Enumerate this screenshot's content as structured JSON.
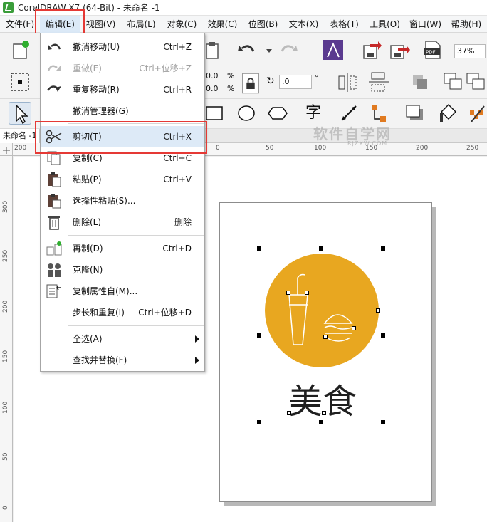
{
  "window": {
    "title": "CorelDRAW X7 (64-Bit) - 未命名 -1"
  },
  "menubar": {
    "items": [
      {
        "label": "文件(F)"
      },
      {
        "label": "编辑(E)"
      },
      {
        "label": "视图(V)"
      },
      {
        "label": "布局(L)"
      },
      {
        "label": "对象(C)"
      },
      {
        "label": "效果(C)"
      },
      {
        "label": "位图(B)"
      },
      {
        "label": "文本(X)"
      },
      {
        "label": "表格(T)"
      },
      {
        "label": "工具(O)"
      },
      {
        "label": "窗口(W)"
      },
      {
        "label": "帮助(H)"
      }
    ]
  },
  "toolbar": {
    "zoom_value": "37%",
    "field_a": "0.0",
    "field_b": "0.0",
    "percent_a": "%",
    "percent_b": "%",
    "rotate_value": ".0",
    "degree_symbol": "°",
    "char_tool": "字"
  },
  "document": {
    "tab_label": "未命名 -1"
  },
  "watermark": {
    "main": "软件自学网",
    "sub": "RJZXW.COM"
  },
  "ruler": {
    "h_labels": [
      "200",
      "150",
      "0",
      "50",
      "100",
      "150",
      "200",
      "250"
    ],
    "v_labels": [
      "300",
      "250",
      "200",
      "150",
      "100",
      "50",
      "0"
    ]
  },
  "artwork": {
    "text": "美食",
    "circle_color": "#E8A720"
  },
  "edit_menu": {
    "items": [
      {
        "label": "撤消移动(U)",
        "shortcut": "Ctrl+Z",
        "icon": "undo-icon",
        "disabled": false
      },
      {
        "label": "重做(E)",
        "shortcut": "Ctrl+位移+Z",
        "icon": "redo-icon",
        "disabled": true
      },
      {
        "label": "重复移动(R)",
        "shortcut": "Ctrl+R",
        "icon": "repeat-icon",
        "disabled": false
      },
      {
        "label": "撤消管理器(G)",
        "shortcut": "",
        "icon": "",
        "disabled": false
      },
      {
        "label": "剪切(T)",
        "shortcut": "Ctrl+X",
        "icon": "scissors-icon",
        "disabled": false,
        "highlighted": true
      },
      {
        "label": "复制(C)",
        "shortcut": "Ctrl+C",
        "icon": "copy-icon",
        "disabled": false
      },
      {
        "label": "粘贴(P)",
        "shortcut": "Ctrl+V",
        "icon": "paste-icon",
        "disabled": false
      },
      {
        "label": "选择性粘贴(S)...",
        "shortcut": "",
        "icon": "paste-special-icon",
        "disabled": false
      },
      {
        "label": "删除(L)",
        "shortcut": "删除",
        "icon": "trash-icon",
        "disabled": false
      },
      {
        "label": "再制(D)",
        "shortcut": "Ctrl+D",
        "icon": "duplicate-icon",
        "disabled": false
      },
      {
        "label": "克隆(N)",
        "shortcut": "",
        "icon": "clone-icon",
        "disabled": false
      },
      {
        "label": "复制属性自(M)...",
        "shortcut": "",
        "icon": "copy-properties-icon",
        "disabled": false
      },
      {
        "label": "步长和重复(I)",
        "shortcut": "Ctrl+位移+D",
        "icon": "",
        "disabled": false
      },
      {
        "label": "全选(A)",
        "shortcut": "",
        "icon": "",
        "disabled": false,
        "submenu": true
      },
      {
        "label": "查找并替换(F)",
        "shortcut": "",
        "icon": "",
        "disabled": false,
        "submenu": true
      }
    ]
  }
}
